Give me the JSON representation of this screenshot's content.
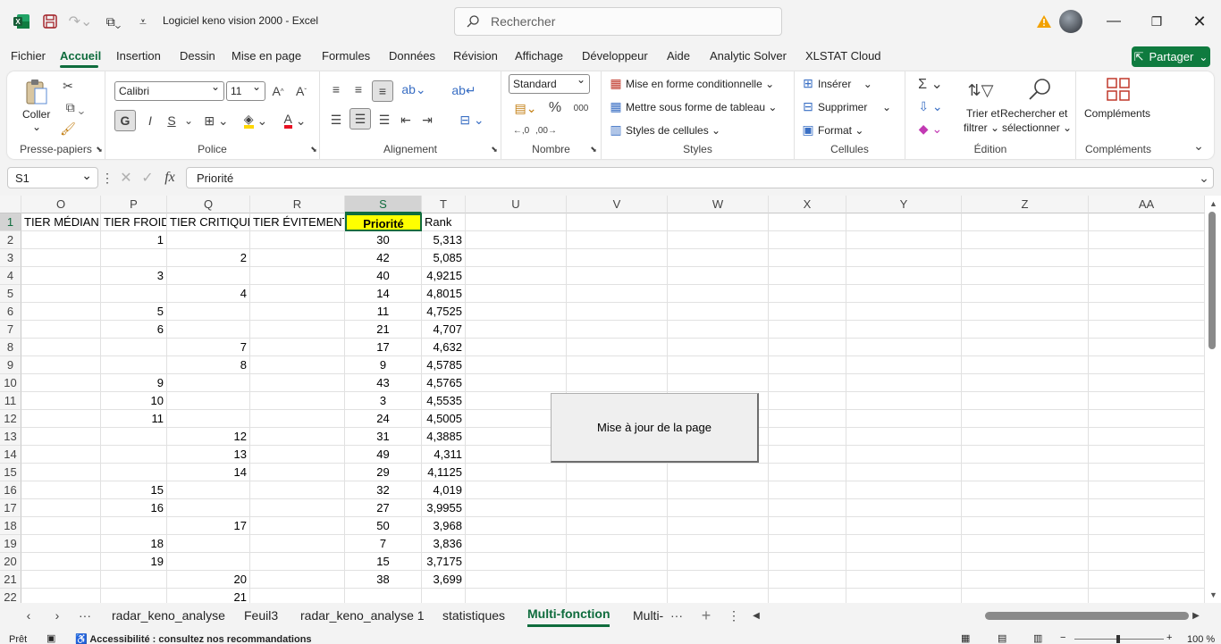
{
  "app": {
    "title": "Logiciel keno vision 2000  -  Excel"
  },
  "search": {
    "placeholder": "Rechercher"
  },
  "menu": [
    "Fichier",
    "Accueil",
    "Insertion",
    "Dessin",
    "Mise en page",
    "Formules",
    "Données",
    "Révision",
    "Affichage",
    "Développeur",
    "Aide",
    "Analytic Solver",
    "XLSTAT Cloud"
  ],
  "share_label": "Partager",
  "ribbon": {
    "clipboard": {
      "paste": "Coller",
      "group": "Presse-papiers"
    },
    "font": {
      "name": "Calibri",
      "size": "11",
      "bold": "G",
      "italic": "I",
      "underline": "S",
      "group": "Police"
    },
    "alignment": {
      "group": "Alignement"
    },
    "number": {
      "format": "Standard",
      "group": "Nombre"
    },
    "styles": {
      "conditional": "Mise en forme conditionnelle",
      "table": "Mettre sous forme de tableau",
      "cell": "Styles de cellules",
      "group": "Styles"
    },
    "cells": {
      "insert": "Insérer",
      "delete": "Supprimer",
      "format": "Format",
      "group": "Cellules"
    },
    "editing": {
      "sort_1": "Trier et",
      "sort_2": "filtrer",
      "find_1": "Rechercher et",
      "find_2": "sélectionner",
      "group": "Édition"
    },
    "addins": {
      "label": "Compléments",
      "group": "Compléments"
    }
  },
  "formula": {
    "namebox": "S1",
    "fx": "fx",
    "content": "Priorité"
  },
  "columns": [
    "O",
    "P",
    "Q",
    "R",
    "S",
    "T",
    "U",
    "V",
    "W",
    "X",
    "Y",
    "Z",
    "AA"
  ],
  "rows": [
    "1",
    "2",
    "3",
    "4",
    "5",
    "6",
    "7",
    "8",
    "9",
    "10",
    "11",
    "12",
    "13",
    "14",
    "15",
    "16",
    "17",
    "18",
    "19",
    "20",
    "21",
    "22"
  ],
  "headers": {
    "O": "TIER MÉDIAN",
    "P": "TIER FROID",
    "Q": "TIER CRITIQUE",
    "R": "TIER ÉVITEMENT",
    "S": "Priorité",
    "T": "Rank"
  },
  "data": [
    {
      "P": "1",
      "Q": "",
      "S": "30",
      "T": "5,313"
    },
    {
      "P": "",
      "Q": "2",
      "S": "42",
      "T": "5,085"
    },
    {
      "P": "3",
      "Q": "",
      "S": "40",
      "T": "4,9215"
    },
    {
      "P": "",
      "Q": "4",
      "S": "14",
      "T": "4,8015"
    },
    {
      "P": "5",
      "Q": "",
      "S": "11",
      "T": "4,7525"
    },
    {
      "P": "6",
      "Q": "",
      "S": "21",
      "T": "4,707"
    },
    {
      "P": "",
      "Q": "7",
      "S": "17",
      "T": "4,632"
    },
    {
      "P": "",
      "Q": "8",
      "S": "9",
      "T": "4,5785"
    },
    {
      "P": "9",
      "Q": "",
      "S": "43",
      "T": "4,5765"
    },
    {
      "P": "10",
      "Q": "",
      "S": "3",
      "T": "4,5535"
    },
    {
      "P": "11",
      "Q": "",
      "S": "24",
      "T": "4,5005"
    },
    {
      "P": "",
      "Q": "12",
      "S": "31",
      "T": "4,3885"
    },
    {
      "P": "",
      "Q": "13",
      "S": "49",
      "T": "4,311"
    },
    {
      "P": "",
      "Q": "14",
      "S": "29",
      "T": "4,1125"
    },
    {
      "P": "15",
      "Q": "",
      "S": "32",
      "T": "4,019"
    },
    {
      "P": "16",
      "Q": "",
      "S": "27",
      "T": "3,9955"
    },
    {
      "P": "",
      "Q": "17",
      "S": "50",
      "T": "3,968"
    },
    {
      "P": "18",
      "Q": "",
      "S": "7",
      "T": "3,836"
    },
    {
      "P": "19",
      "Q": "",
      "S": "15",
      "T": "3,7175"
    },
    {
      "P": "",
      "Q": "20",
      "S": "38",
      "T": "3,699"
    },
    {
      "P": "",
      "Q": "21",
      "S": "",
      "T": ""
    }
  ],
  "macro_button": "Mise à jour de la page",
  "sheets": [
    "radar_keno_analyse",
    "Feuil3",
    "radar_keno_analyse 1",
    "statistiques",
    "Multi-fonction",
    "Multi-"
  ],
  "active_sheet": "Multi-fonction",
  "status": {
    "ready": "Prêt",
    "accessibility": "Accessibilité : consultez nos recommandations",
    "zoom": "100 %"
  },
  "colors": {
    "accent": "#0f6c3d",
    "highlight": "#ffff00"
  }
}
